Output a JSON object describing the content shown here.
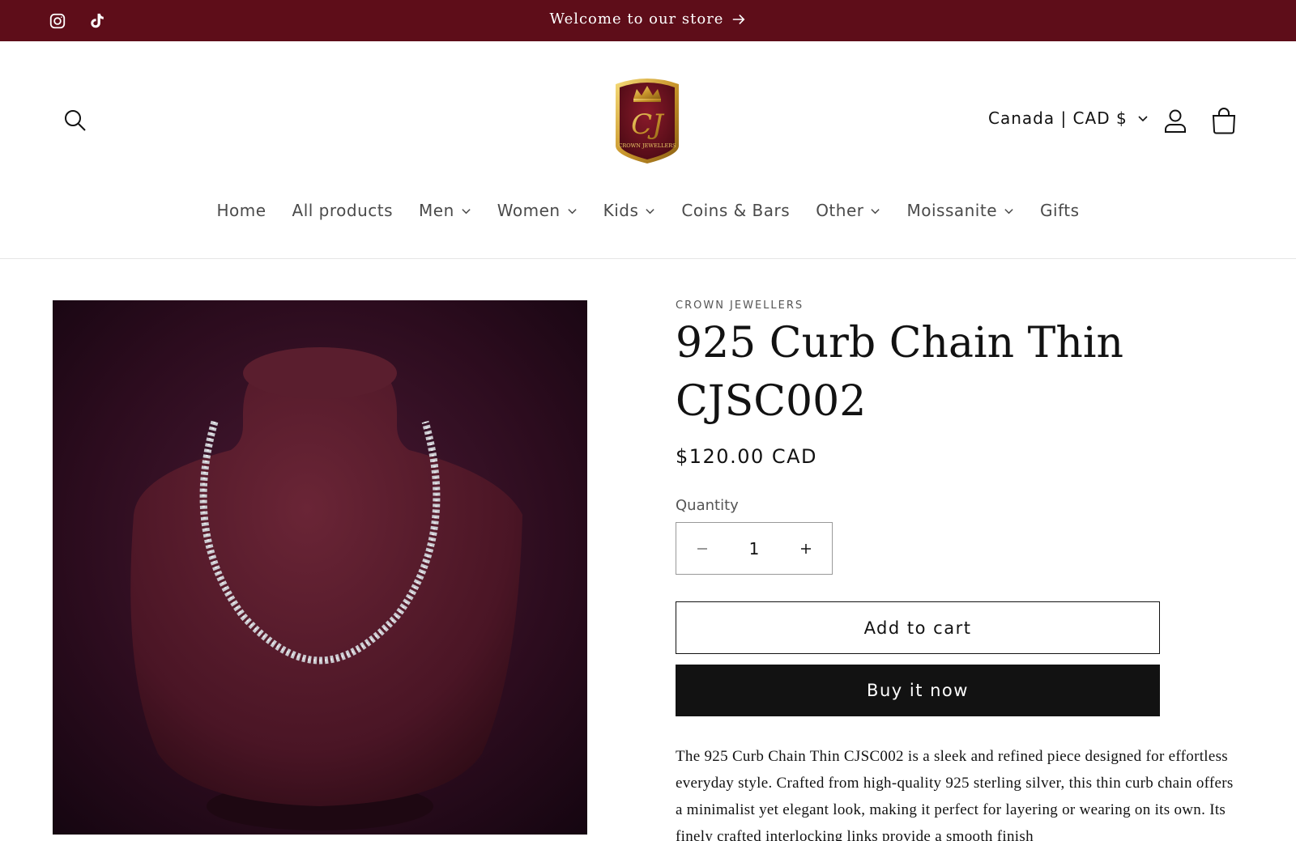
{
  "announcement": {
    "message": "Welcome to our store",
    "background": "#5e0d19",
    "social_icons": [
      "instagram-icon",
      "tiktok-icon"
    ]
  },
  "header": {
    "logo_text": "CROWN JEWELLERS",
    "logo_monogram": "CJ",
    "locale": "Canada | CAD $",
    "icons": [
      "search-icon",
      "account-icon",
      "cart-icon"
    ]
  },
  "nav": {
    "items": [
      {
        "label": "Home",
        "has_dropdown": false
      },
      {
        "label": "All products",
        "has_dropdown": false
      },
      {
        "label": "Men",
        "has_dropdown": true
      },
      {
        "label": "Women",
        "has_dropdown": true
      },
      {
        "label": "Kids",
        "has_dropdown": true
      },
      {
        "label": "Coins & Bars",
        "has_dropdown": false
      },
      {
        "label": "Other",
        "has_dropdown": true
      },
      {
        "label": "Moissanite",
        "has_dropdown": true
      },
      {
        "label": "Gifts",
        "has_dropdown": false
      }
    ]
  },
  "product": {
    "vendor": "CROWN JEWELLERS",
    "title": "925 Curb Chain Thin CJSC002",
    "price": "$120.00 CAD",
    "quantity_label": "Quantity",
    "quantity_value": "1",
    "add_to_cart_label": "Add to cart",
    "buy_now_label": "Buy it now",
    "description": "The 925 Curb Chain Thin CJSC002 is a sleek and refined piece designed for effortless everyday style. Crafted from high-quality 925 sterling silver, this thin curb chain offers a minimalist yet elegant look, making it perfect for layering or wearing on its own. Its finely crafted interlocking links provide a smooth finish"
  }
}
